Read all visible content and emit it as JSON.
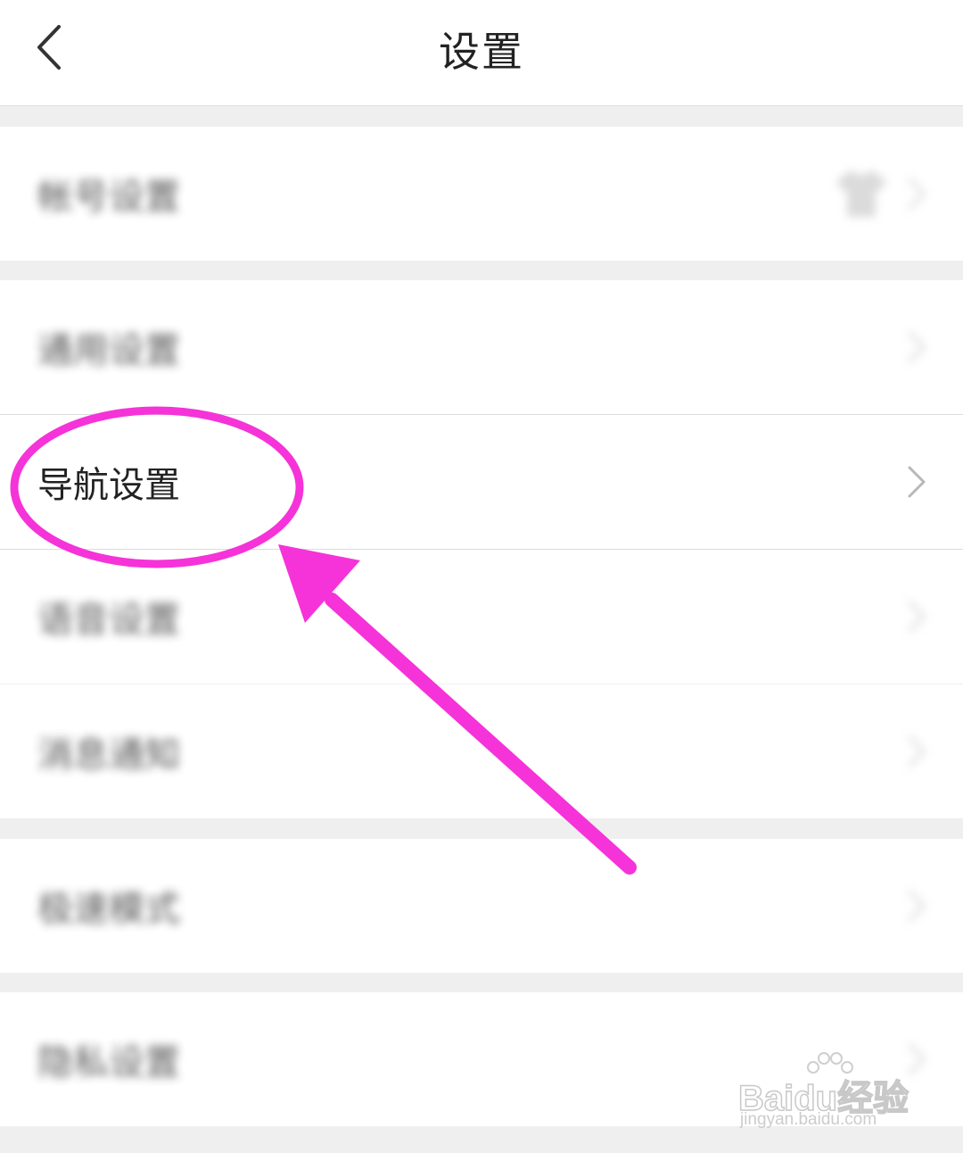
{
  "header": {
    "title": "设置"
  },
  "settings": {
    "items": [
      {
        "label": "帐号设置",
        "blurred": true
      },
      {
        "label": "通用设置",
        "blurred": true
      },
      {
        "label": "导航设置",
        "blurred": false
      },
      {
        "label": "语音设置",
        "blurred": true
      },
      {
        "label": "消息通知",
        "blurred": true
      },
      {
        "label": "极速模式",
        "blurred": true
      },
      {
        "label": "隐私设置",
        "blurred": true
      }
    ]
  },
  "annotation": {
    "color": "#f533d8"
  },
  "watermark": {
    "logo": "Baidu经验",
    "url": "jingyan.baidu.com"
  },
  "colors": {
    "background": "#efefef",
    "surface": "#ffffff",
    "text": "#222222",
    "chevron": "#c4c4c4",
    "accent": "#f533d8"
  }
}
